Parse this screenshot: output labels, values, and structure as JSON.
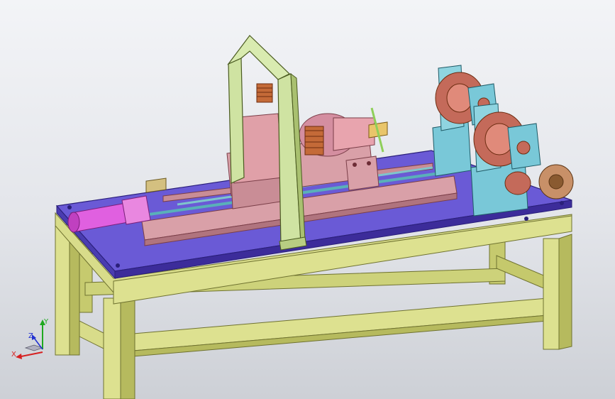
{
  "viewport": {
    "background_top": "#f3f4f7",
    "background_bottom": "#cdd0d6"
  },
  "triad": {
    "x_label": "X",
    "y_label": "Y",
    "z_label": "Z",
    "x_color": "#d62020",
    "y_color": "#1fa81f",
    "z_color": "#2030d0"
  },
  "colors": {
    "frame": "#d8dc8a",
    "frame_dark": "#a9ad55",
    "plate": "#6a5ad6",
    "plate_dark": "#3c2c9a",
    "carriage": "#d9a0a8",
    "carriage_dark": "#b0747e",
    "arch": "#cfe3a2",
    "spring": "#c46a38",
    "winder": "#79c8d8",
    "motor": "#e060e0"
  }
}
